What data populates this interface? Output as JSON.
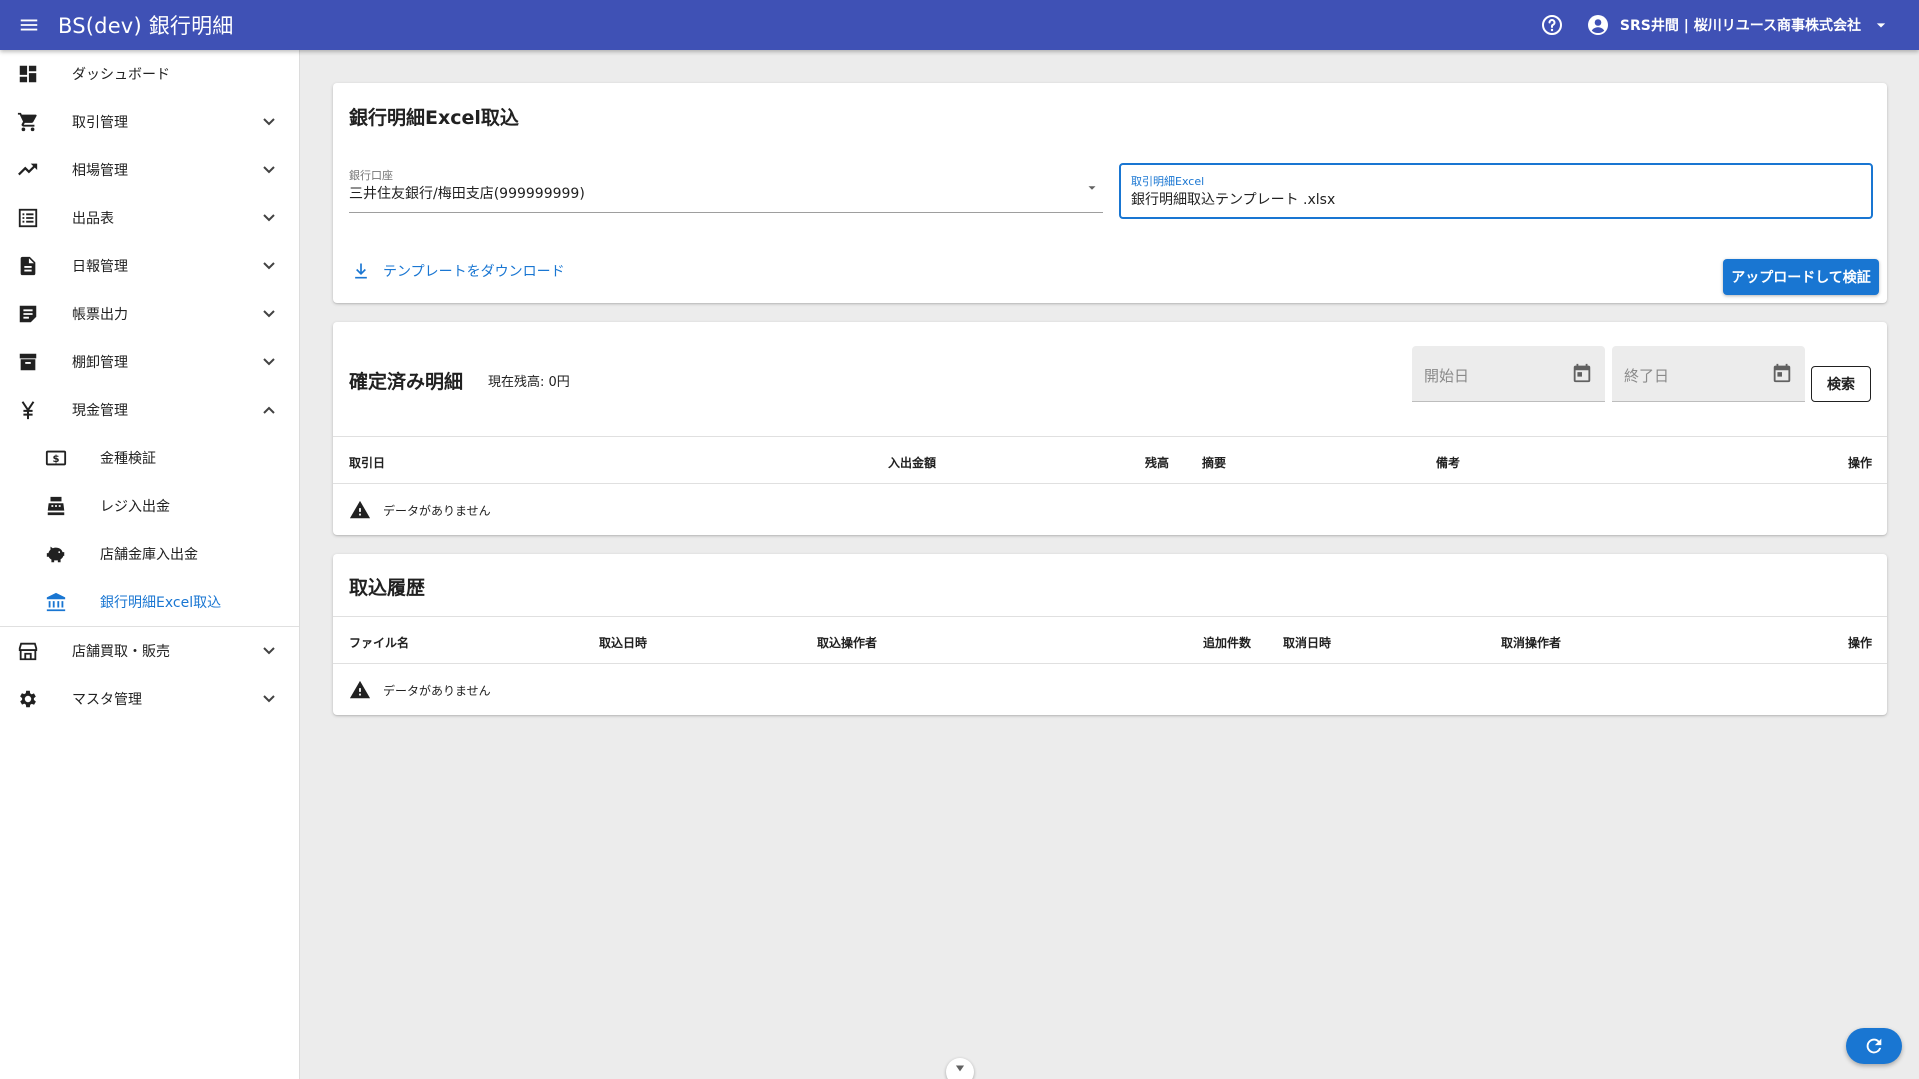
{
  "appbar": {
    "title": "BS(dev) 銀行明細",
    "user": "SRS井間 | 桜川リユース商事株式会社",
    "color": "#3f51b5"
  },
  "sidebar": {
    "items": [
      {
        "label": "ダッシュボード",
        "icon": "dashboard-icon"
      },
      {
        "label": "取引管理",
        "icon": "cart-icon"
      },
      {
        "label": "相場管理",
        "icon": "trending-up-icon"
      },
      {
        "label": "出品表",
        "icon": "list-icon"
      },
      {
        "label": "日報管理",
        "icon": "document-icon"
      },
      {
        "label": "帳票出力",
        "icon": "note-icon"
      },
      {
        "label": "棚卸管理",
        "icon": "archive-icon"
      },
      {
        "label": "現金管理",
        "icon": "yen-icon"
      },
      {
        "label": "店舗買取・販売",
        "icon": "store-icon"
      },
      {
        "label": "マスタ管理",
        "icon": "gear-icon"
      }
    ],
    "cash_sub": [
      {
        "label": "金種検証",
        "icon": "money-bill-icon"
      },
      {
        "label": "レジ入出金",
        "icon": "cash-register-icon"
      },
      {
        "label": "店舗金庫入出金",
        "icon": "piggy-bank-icon"
      },
      {
        "label": "銀行明細Excel取込",
        "icon": "bank-icon"
      }
    ],
    "active_color": "#1976d2"
  },
  "import_card": {
    "title": "銀行明細Excel取込",
    "account_label": "銀行口座",
    "account_value": "三井住友銀行/梅田支店(999999999)",
    "file_label": "取引明細Excel",
    "file_value": "銀行明細取込テンプレート .xlsx",
    "download_link": "テンプレートをダウンロード",
    "upload_button": "アップロードして検証"
  },
  "confirmed_card": {
    "title": "確定済み明細",
    "balance": "現在残高: 0円",
    "start_date_placeholder": "開始日",
    "end_date_placeholder": "終了日",
    "search_button": "検索",
    "columns": [
      "取引日",
      "入出金額",
      "残高",
      "摘要",
      "備考",
      "操作"
    ],
    "empty_text": "データがありません"
  },
  "history_card": {
    "title": "取込履歴",
    "columns": [
      "ファイル名",
      "取込日時",
      "取込操作者",
      "追加件数",
      "取消日時",
      "取消操作者",
      "操作"
    ],
    "empty_text": "データがありません"
  }
}
